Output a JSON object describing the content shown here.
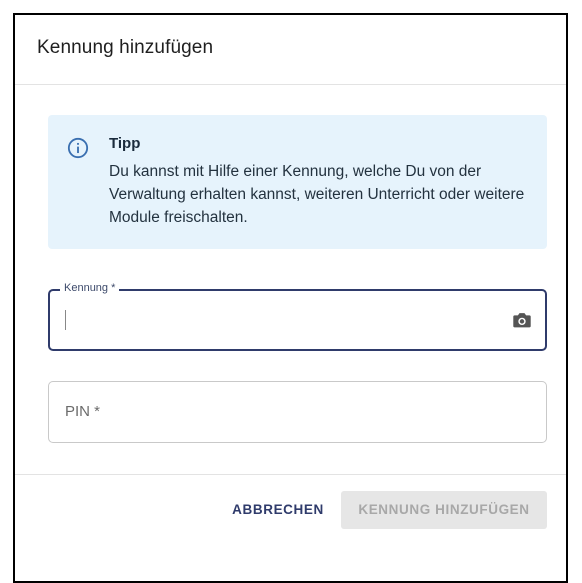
{
  "dialog": {
    "title": "Kennung hinzufügen"
  },
  "tip": {
    "icon": "info-icon",
    "title": "Tipp",
    "text": "Du kannst mit Hilfe einer Kennung, welche Du von der Verwaltung erhalten kannst, weiteren Unterricht oder weitere Module freischalten."
  },
  "fields": {
    "kennung": {
      "label": "Kennung *",
      "value": "",
      "icon": "camera-icon"
    },
    "pin": {
      "placeholder": "PIN *",
      "value": ""
    }
  },
  "actions": {
    "cancel_label": "Abbrechen",
    "add_label": "Kennung hinzufügen"
  },
  "colors": {
    "accent": "#2f3b6b",
    "tip_background": "#e6f3fc",
    "disabled_button_bg": "#e6e6e6",
    "disabled_button_text": "#a8a8a8"
  }
}
